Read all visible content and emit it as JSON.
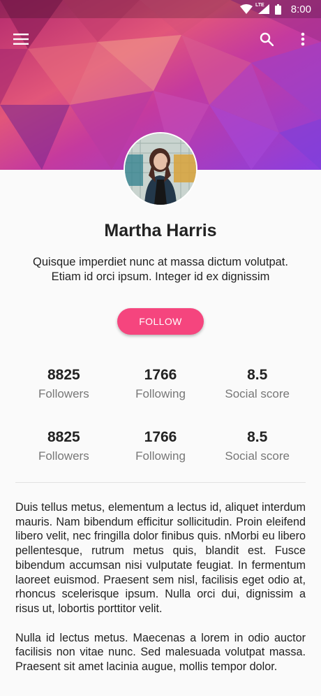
{
  "status_bar": {
    "time": "8:00",
    "network": "LTE",
    "icons": [
      "wifi-icon",
      "signal-icon",
      "battery-icon"
    ]
  },
  "toolbar": {
    "menu_icon": "menu-icon",
    "search_icon": "search-icon",
    "more_icon": "more-vert-icon"
  },
  "profile": {
    "name": "Martha Harris",
    "tagline": "Quisque imperdiet nunc at massa dictum volutpat. Etiam id orci ipsum. Integer id ex dignissim",
    "follow_label": "FOLLOW"
  },
  "stats_rows": [
    [
      {
        "value": "8825",
        "label": "Followers"
      },
      {
        "value": "1766",
        "label": "Following"
      },
      {
        "value": "8.5",
        "label": "Social score"
      }
    ],
    [
      {
        "value": "8825",
        "label": "Followers"
      },
      {
        "value": "1766",
        "label": "Following"
      },
      {
        "value": "8.5",
        "label": "Social score"
      }
    ]
  ],
  "paragraphs": [
    "Duis tellus metus, elementum a lectus id, aliquet interdum mauris. Nam bibendum efficitur sollicitudin. Proin eleifend libero velit, nec fringilla dolor finibus quis. nMorbi eu libero pellentesque, rutrum metus quis, blandit est. Fusce bibendum accumsan nisi vulputate feugiat. In fermentum laoreet euismod. Praesent sem nisl, facilisis eget odio at, rhoncus scelerisque ipsum. Nulla orci dui, dignissim a risus ut, lobortis porttitor velit.",
    "Nulla id lectus metus. Maecenas a lorem in odio auctor facilisis non vitae nunc. Sed malesuada volutpat massa. Praesent sit amet lacinia augue, mollis tempor dolor."
  ],
  "colors": {
    "accent": "#f5457e",
    "header_primary": "#c2309a",
    "header_secondary": "#9b3fd6"
  }
}
